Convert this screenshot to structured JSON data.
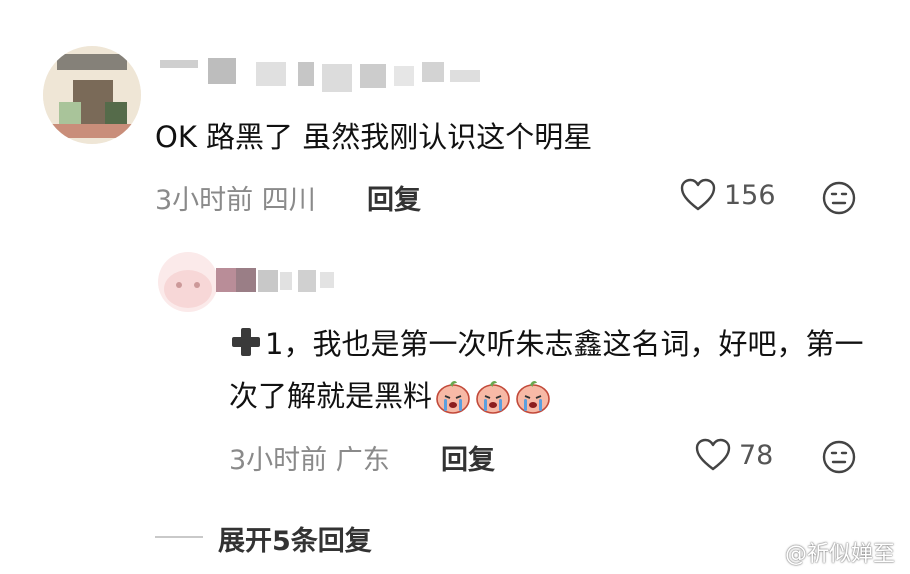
{
  "comment": {
    "text": "OK 路黑了 虽然我刚认识这个明星",
    "time": "3小时前",
    "location": "四川",
    "reply_label": "回复",
    "likes": "156",
    "icons": {
      "like": "heart-outline-icon",
      "more": "emoji-face-icon"
    }
  },
  "reply": {
    "text_prefix": "1，我也是第一次听朱志鑫这名词，好吧，第一次了解就是黑料",
    "time": "3小时前",
    "location": "广东",
    "reply_label": "回复",
    "likes": "78",
    "icons": {
      "plus": "heavy-plus-icon",
      "emoji": "crying-peach-emoji"
    }
  },
  "expand": {
    "label": "展开5条回复"
  },
  "watermark": {
    "text": "@祈似婵至"
  }
}
